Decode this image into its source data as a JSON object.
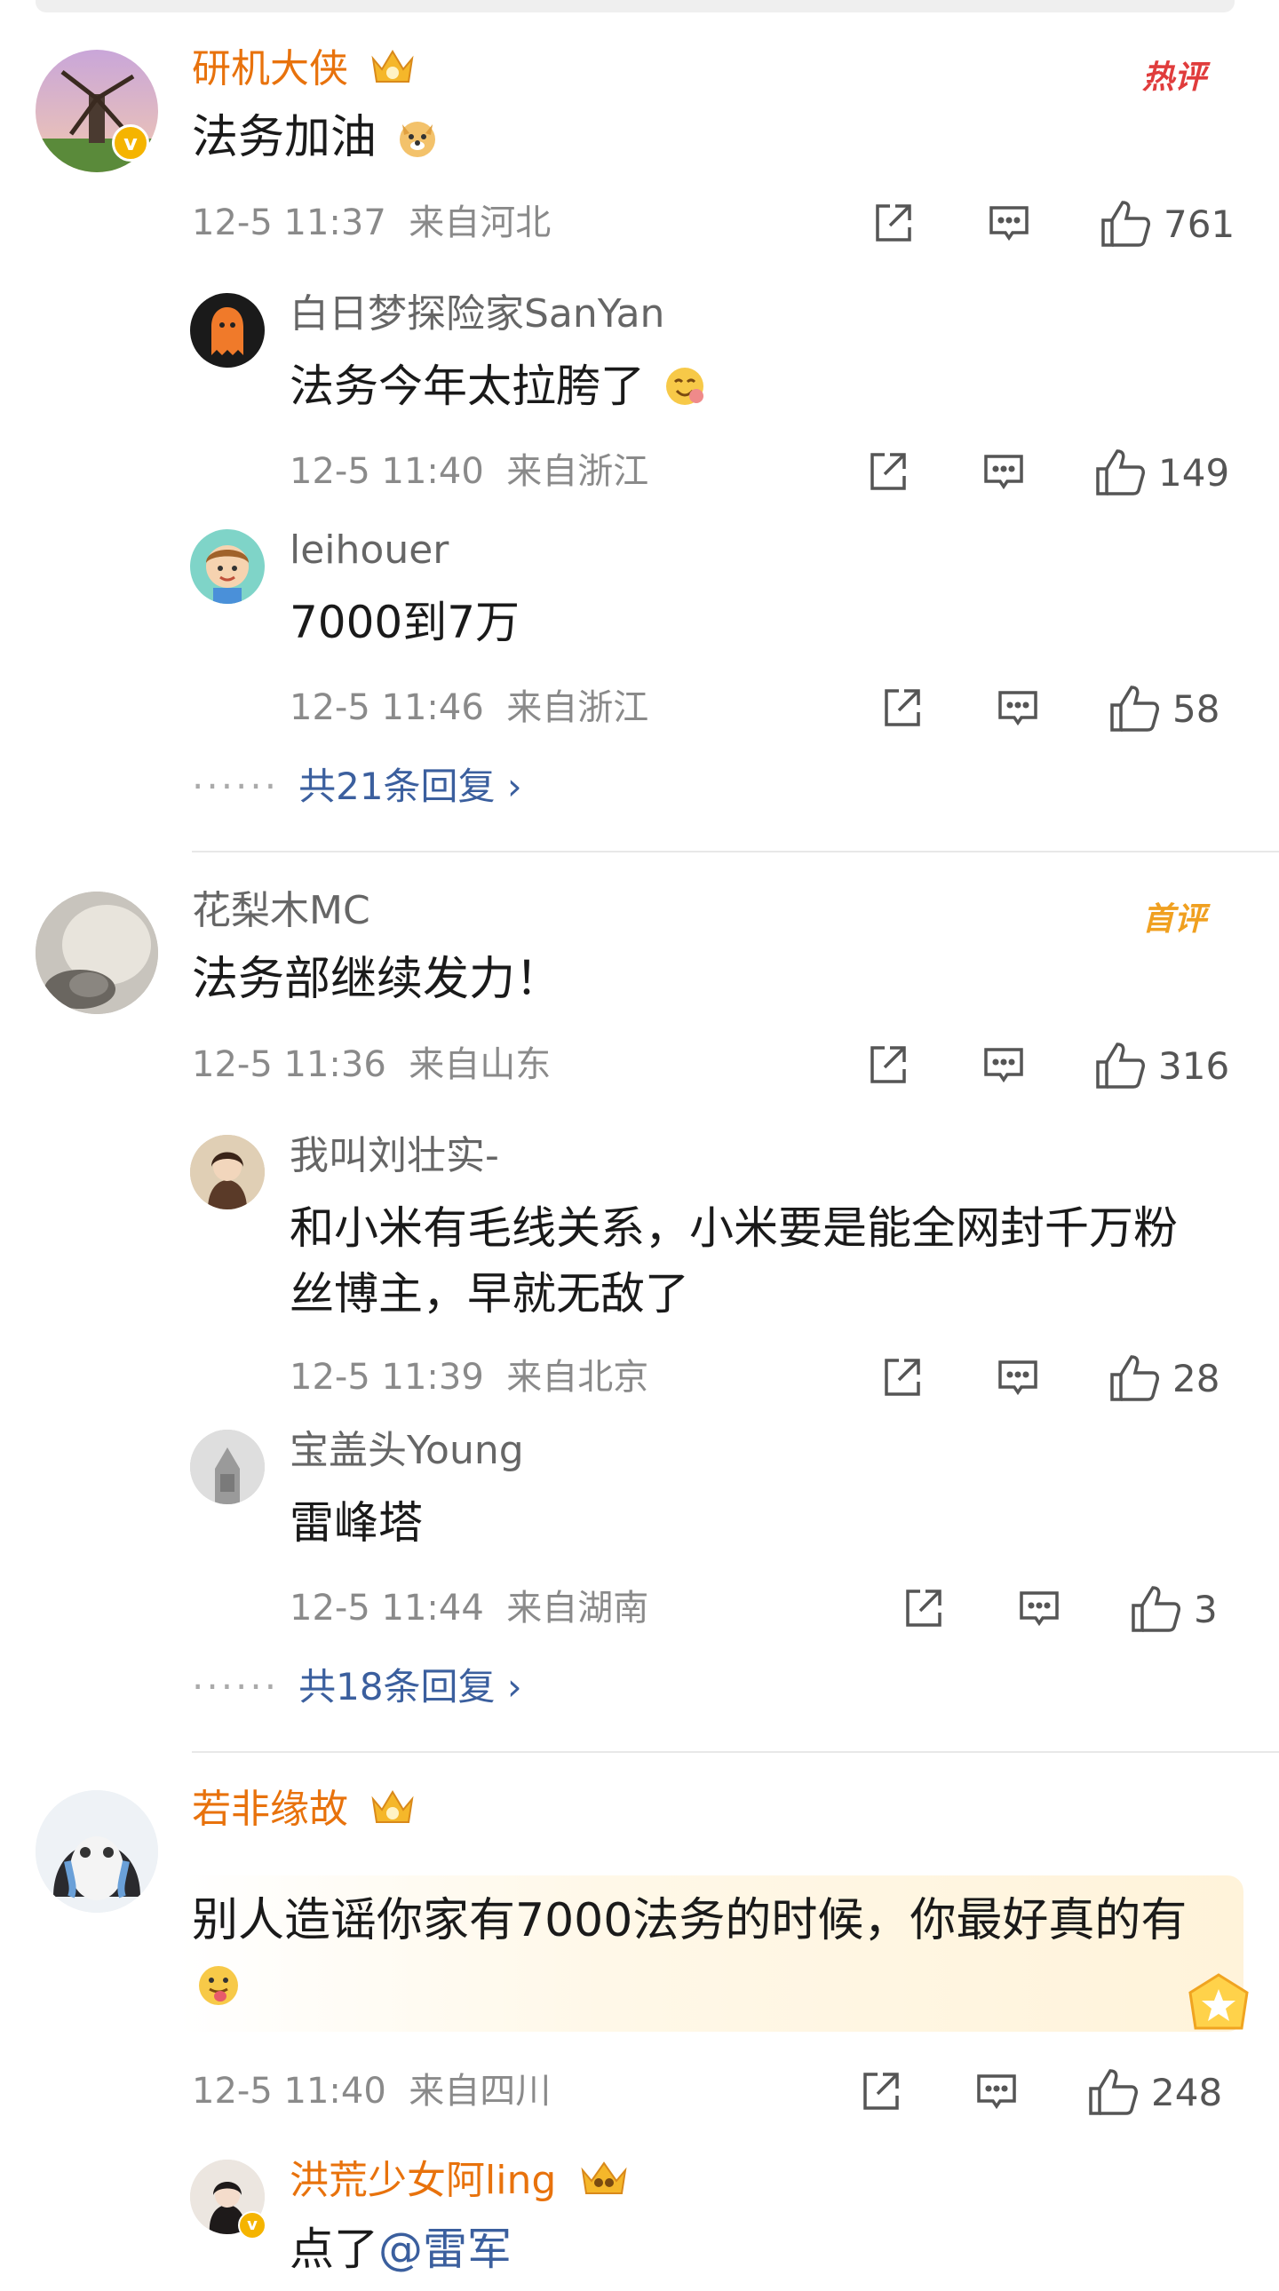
{
  "comments": [
    {
      "name": "研机大侠",
      "badge": "热评",
      "text": "法务加油",
      "time": "12-5 11:37",
      "location": "来自河北",
      "likes": "761",
      "replies": [
        {
          "name": "白日梦探险家SanYan",
          "text": "法务今年太拉胯了",
          "time": "12-5 11:40",
          "location": "来自浙江",
          "likes": "149"
        },
        {
          "name": "leihouer",
          "text": "7000到7万",
          "time": "12-5 11:46",
          "location": "来自浙江",
          "likes": "58"
        }
      ],
      "more_replies": "共21条回复 ›"
    },
    {
      "name": "花梨木MC",
      "badge": "首评",
      "text": "法务部继续发力！",
      "time": "12-5 11:36",
      "location": "来自山东",
      "likes": "316",
      "replies": [
        {
          "name": "我叫刘壮实-",
          "text_line1": "和小米有毛线关系，小米要是能全网封千万粉",
          "text_line2": "丝博主，早就无敌了",
          "time": "12-5 11:39",
          "location": "来自北京",
          "likes": "28"
        },
        {
          "name": "宝盖头Young",
          "text": "雷峰塔",
          "time": "12-5 11:44",
          "location": "来自湖南",
          "likes": "3"
        }
      ],
      "more_replies": "共18条回复 ›"
    },
    {
      "name": "若非缘故",
      "text": "别人造谣你家有7000法务的时候，你最好真的有",
      "time": "12-5 11:40",
      "location": "来自四川",
      "likes": "248",
      "replies": [
        {
          "name": "洪荒少女阿ling",
          "text_prefix": "点了",
          "mention": "@雷军"
        }
      ]
    }
  ],
  "colors": {
    "vip_name": "#e8720c",
    "link": "#3b5f9e",
    "hot_badge": "#e03c3c",
    "first_badge": "#f0a020"
  },
  "icons": [
    "share-icon",
    "comment-icon",
    "like-icon",
    "crown-icon",
    "verified-icon"
  ]
}
